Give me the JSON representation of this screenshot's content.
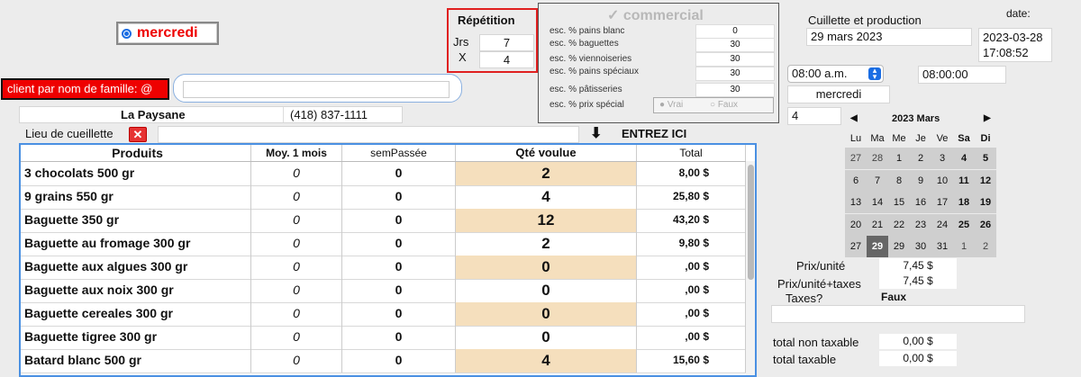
{
  "day_button": {
    "label": "mercredi"
  },
  "repetition": {
    "title": "Répétition",
    "jrs_label": "Jrs",
    "jrs_value": "7",
    "x_label": "X",
    "x_value": "4"
  },
  "commercial": {
    "title": "commercial",
    "rows": [
      {
        "label": "esc. % pains blanc",
        "value": "0"
      },
      {
        "label": "esc. % baguettes",
        "value": "30"
      },
      {
        "label": "esc. % viennoiseries",
        "value": "30"
      },
      {
        "label": "esc. % pains spéciaux",
        "value": "30"
      },
      {
        "label": "esc. % pâtisseries",
        "value": "30"
      }
    ],
    "prix_special_label": "esc. % prix spécial",
    "vrai": "Vrai",
    "faux": "Faux"
  },
  "client": {
    "label": "client  par nom de famille: @",
    "value": ""
  },
  "store": {
    "name": "La Paysane",
    "phone": "(418) 837-1111"
  },
  "lieu": {
    "label": "Lieu de cueillette",
    "value": ""
  },
  "entrez": "ENTREZ ICI",
  "table": {
    "headers": [
      "Produits",
      "Moy. 1 mois",
      "semPassée",
      "Qté voulue",
      "Total"
    ],
    "rows": [
      {
        "produit": "3 chocolats 500 gr",
        "moy": "0",
        "sem": "0",
        "qte": "2",
        "total": "8,00 $",
        "hl": true
      },
      {
        "produit": "9 grains 550 gr",
        "moy": "0",
        "sem": "0",
        "qte": "4",
        "total": "25,80 $",
        "hl": false
      },
      {
        "produit": "Baguette 350 gr",
        "moy": "0",
        "sem": "0",
        "qte": "12",
        "total": "43,20 $",
        "hl": true
      },
      {
        "produit": "Baguette au fromage 300 gr",
        "moy": "0",
        "sem": "0",
        "qte": "2",
        "total": "9,80 $",
        "hl": false
      },
      {
        "produit": "Baguette aux algues 300 gr",
        "moy": "0",
        "sem": "0",
        "qte": "0",
        "total": ",00 $",
        "hl": true
      },
      {
        "produit": "Baguette aux noix 300 gr",
        "moy": "0",
        "sem": "0",
        "qte": "0",
        "total": ",00 $",
        "hl": false
      },
      {
        "produit": "Baguette cereales 300 gr",
        "moy": "0",
        "sem": "0",
        "qte": "0",
        "total": ",00 $",
        "hl": true
      },
      {
        "produit": "Baguette tigree 300 gr",
        "moy": "0",
        "sem": "0",
        "qte": "0",
        "total": ",00 $",
        "hl": false
      },
      {
        "produit": "Batard blanc 500 gr",
        "moy": "0",
        "sem": "0",
        "qte": "4",
        "total": "15,60 $",
        "hl": true
      }
    ]
  },
  "cueillette": {
    "label": "Cuillette et production",
    "value": "29 mars 2023"
  },
  "date": {
    "label": "date:",
    "value": "2023-03-28",
    "time": "17:08:52"
  },
  "time_select": {
    "value": "08:00 a.m."
  },
  "time_field": "08:00:00",
  "day_field": "mercredi",
  "num_field": "4",
  "calendar": {
    "title": "2023 Mars",
    "dows": [
      "Lu",
      "Ma",
      "Me",
      "Je",
      "Ve",
      "Sa",
      "Di"
    ],
    "weeks": [
      [
        "27",
        "28",
        "1",
        "2",
        "3",
        "4",
        "5"
      ],
      [
        "6",
        "7",
        "8",
        "9",
        "10",
        "11",
        "12"
      ],
      [
        "13",
        "14",
        "15",
        "16",
        "17",
        "18",
        "19"
      ],
      [
        "20",
        "21",
        "22",
        "23",
        "24",
        "25",
        "26"
      ],
      [
        "27",
        "29",
        "29",
        "30",
        "31",
        "1",
        "2"
      ]
    ],
    "selected": "29"
  },
  "prix": {
    "unite_label": "Prix/unité",
    "unite_value": "7,45 $",
    "taxes_label": "Prix/unité+taxes",
    "taxes_value": "7,45 $",
    "taxes_q_label": "Taxes?",
    "taxes_q_value": "Faux"
  },
  "totals": {
    "non_taxable_label": "total non taxable",
    "non_taxable_value": "0,00 $",
    "taxable_label": "total taxable",
    "taxable_value": "0,00 $"
  }
}
